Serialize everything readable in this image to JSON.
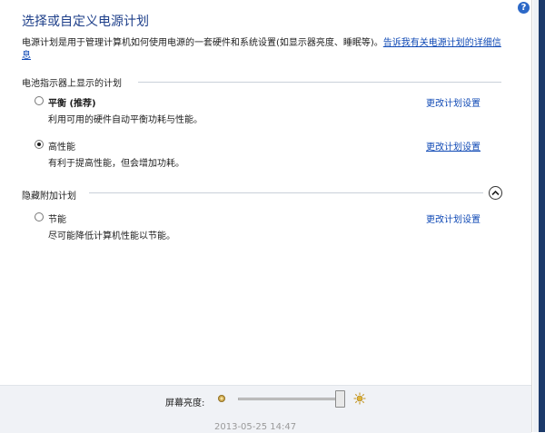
{
  "header": {
    "title": "选择或自定义电源计划",
    "description": "电源计划是用于管理计算机如何使用电源的一套硬件和系统设置(如显示器亮度、睡眠等)。",
    "learn_more_link": "告诉我有关电源计划的详细信息",
    "help_icon": "question-mark",
    "help_icon_glyph": "?"
  },
  "section_battery": {
    "label": "电池指示器上显示的计划",
    "plans": [
      {
        "name": "平衡 (推荐)",
        "description": "利用可用的硬件自动平衡功耗与性能。",
        "selected": false,
        "change_label": "更改计划设置"
      },
      {
        "name": "高性能",
        "description": "有利于提高性能，但会增加功耗。",
        "selected": true,
        "change_label": "更改计划设置"
      }
    ]
  },
  "section_hidden": {
    "label": "隐藏附加计划",
    "expand_icon": "chevron-up",
    "plans": [
      {
        "name": "节能",
        "description": "尽可能降低计算机性能以节能。",
        "selected": false,
        "change_label": "更改计划设置"
      }
    ]
  },
  "footer": {
    "brightness_label": "屏幕亮度:",
    "brightness_level": 1.0,
    "dim_icon": "sun-dim",
    "bright_icon": "sun-bright",
    "partial_text": "2013-05-25 14:47"
  },
  "colors": {
    "title": "#1e3f8a",
    "link": "#0f49b5",
    "help_icon": "#2c68c7",
    "footer_bg": "#f0f2f6",
    "frame_accent": "#1c3a6a",
    "sun_dim": "#c8a24a",
    "sun_bright": "#e0b43a"
  }
}
